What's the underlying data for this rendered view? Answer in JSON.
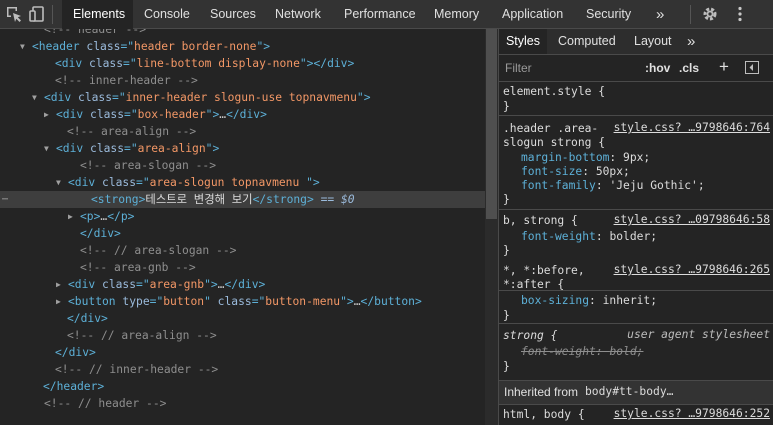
{
  "toolbar": {
    "tabs": [
      "Elements",
      "Console",
      "Sources",
      "Network",
      "Performance",
      "Memory",
      "Application",
      "Security"
    ],
    "more_label": "»"
  },
  "elements": [
    {
      "parts": [
        [
          "cmt",
          "<!-- header -->"
        ]
      ]
    },
    {
      "parts": [
        [
          "tag",
          "<header "
        ],
        [
          "attr",
          "class"
        ],
        [
          "tag",
          "=\""
        ],
        [
          "val",
          "header border-none"
        ],
        [
          "tag",
          "\">"
        ]
      ]
    },
    {
      "parts": [
        [
          "tag",
          "<div "
        ],
        [
          "attr",
          "class"
        ],
        [
          "tag",
          "=\""
        ],
        [
          "val",
          "line-bottom display-none"
        ],
        [
          "tag",
          "\"></div>"
        ]
      ]
    },
    {
      "parts": [
        [
          "cmt",
          "<!-- inner-header -->"
        ]
      ]
    },
    {
      "parts": [
        [
          "tag",
          "<div "
        ],
        [
          "attr",
          "class"
        ],
        [
          "tag",
          "=\""
        ],
        [
          "val",
          "inner-header slogun-use topnavmenu"
        ],
        [
          "tag",
          "\">"
        ]
      ]
    },
    {
      "parts": [
        [
          "tag",
          "<div "
        ],
        [
          "attr",
          "class"
        ],
        [
          "tag",
          "=\""
        ],
        [
          "val",
          "box-header"
        ],
        [
          "tag",
          "\">"
        ],
        [
          "ell",
          "…"
        ],
        [
          "tag",
          "</div>"
        ]
      ]
    },
    {
      "parts": [
        [
          "cmt",
          "<!-- area-align -->"
        ]
      ]
    },
    {
      "parts": [
        [
          "tag",
          "<div "
        ],
        [
          "attr",
          "class"
        ],
        [
          "tag",
          "=\""
        ],
        [
          "val",
          "area-align"
        ],
        [
          "tag",
          "\">"
        ]
      ]
    },
    {
      "parts": [
        [
          "cmt",
          "<!-- area-slogan -->"
        ]
      ]
    },
    {
      "parts": [
        [
          "tag",
          "<div "
        ],
        [
          "attr",
          "class"
        ],
        [
          "tag",
          "=\""
        ],
        [
          "val",
          "area-slogun topnavmenu "
        ],
        [
          "tag",
          "\">"
        ]
      ]
    },
    {
      "parts": [
        [
          "tag",
          "<strong>"
        ],
        [
          "txt",
          "테스트로 변경해 보기"
        ],
        [
          "tag",
          "</strong>"
        ],
        [
          "eq",
          " == $0"
        ]
      ]
    },
    {
      "parts": [
        [
          "tag",
          "<p>"
        ],
        [
          "ell",
          "…"
        ],
        [
          "tag",
          "</p>"
        ]
      ]
    },
    {
      "parts": [
        [
          "tag",
          "</div>"
        ]
      ]
    },
    {
      "parts": [
        [
          "cmt",
          "<!-- // area-slogan -->"
        ]
      ]
    },
    {
      "parts": [
        [
          "cmt",
          "<!-- area-gnb -->"
        ]
      ]
    },
    {
      "parts": [
        [
          "tag",
          "<div "
        ],
        [
          "attr",
          "class"
        ],
        [
          "tag",
          "=\""
        ],
        [
          "val",
          "area-gnb"
        ],
        [
          "tag",
          "\">"
        ],
        [
          "ell",
          "…"
        ],
        [
          "tag",
          "</div>"
        ]
      ]
    },
    {
      "parts": [
        [
          "tag",
          "<button "
        ],
        [
          "attr",
          "type"
        ],
        [
          "tag",
          "=\""
        ],
        [
          "val",
          "button"
        ],
        [
          "tag",
          "\" "
        ],
        [
          "attr",
          "class"
        ],
        [
          "tag",
          "=\""
        ],
        [
          "val",
          "button-menu"
        ],
        [
          "tag",
          "\">"
        ],
        [
          "ell",
          "…"
        ],
        [
          "tag",
          "</button>"
        ]
      ]
    },
    {
      "parts": [
        [
          "tag",
          "</div>"
        ]
      ]
    },
    {
      "parts": [
        [
          "cmt",
          "<!-- // area-align -->"
        ]
      ]
    },
    {
      "parts": [
        [
          "tag",
          "</div>"
        ]
      ]
    },
    {
      "parts": [
        [
          "cmt",
          "<!-- // inner-header -->"
        ]
      ]
    },
    {
      "parts": [
        [
          "tag",
          "</header>"
        ]
      ]
    },
    {
      "parts": [
        [
          "cmt",
          "<!-- // header -->"
        ]
      ]
    }
  ],
  "styles": {
    "tabs": [
      "Styles",
      "Computed",
      "Layout"
    ],
    "more_label": "»",
    "filter_placeholder": "Filter",
    "hov_label": ":hov",
    "cls_label": ".cls",
    "add_label": "+",
    "element_style_selector": "element.style {",
    "close_brace": "}",
    "rule1": {
      "selector_line1": ".header .area-",
      "selector_line2": "slogun strong {",
      "source": "style.css? …9798646:764",
      "props": [
        {
          "name": "margin-bottom",
          "value": "9px;"
        },
        {
          "name": "font-size",
          "value": "50px;"
        },
        {
          "name": "font-family",
          "value": "'Jeju Gothic';"
        }
      ]
    },
    "rule2": {
      "selector": "b, strong {",
      "source": "style.css? …09798646:58",
      "props": [
        {
          "name": "font-weight",
          "value": "bolder;"
        }
      ]
    },
    "rule3": {
      "selector_line1": "*, *:before,",
      "selector_line2": "*:after {",
      "source": "style.css? …9798646:265",
      "props": [
        {
          "name": "box-sizing",
          "value": "inherit;"
        }
      ]
    },
    "rule4": {
      "selector": "strong {",
      "source": "user agent stylesheet",
      "props": [
        {
          "name": "font-weight",
          "value": "bold;"
        }
      ]
    },
    "inherited_label": "Inherited from",
    "inherited_from": "body#tt-body…",
    "rule5": {
      "selector": "html, body {",
      "source": "style.css? …9798646:252"
    }
  }
}
